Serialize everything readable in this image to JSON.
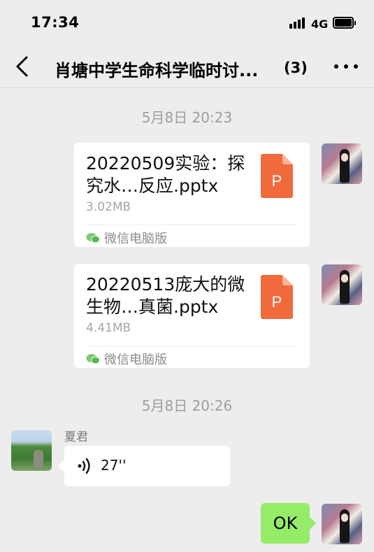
{
  "status_bar": {
    "time": "17:34",
    "network": "4G",
    "signal_icon": "signal-bars-icon",
    "battery_icon": "battery-full-icon"
  },
  "nav": {
    "back_icon": "chevron-left-icon",
    "title": "肖塘中学生命科学临时讨...",
    "member_count": "(3)",
    "more_icon": "more-dots-icon"
  },
  "messages": [
    {
      "type": "timestamp",
      "text": "5月8日 20:23"
    },
    {
      "type": "file",
      "sender": "self",
      "file_name": "20220509实验：探究水…反应.pptx",
      "file_size": "3.02MB",
      "source": "微信电脑版",
      "file_icon": "ppt-file-icon",
      "badge": "P"
    },
    {
      "type": "file",
      "sender": "self",
      "file_name": "20220513庞大的微生物…真菌.pptx",
      "file_size": "4.41MB",
      "source": "微信电脑版",
      "file_icon": "ppt-file-icon",
      "badge": "P"
    },
    {
      "type": "timestamp",
      "text": "5月8日 20:26"
    },
    {
      "type": "voice",
      "sender": "other",
      "sender_name": "夏君",
      "duration": "27''",
      "voice_icon": "voice-wave-icon"
    },
    {
      "type": "text",
      "sender": "self",
      "text": "OK"
    }
  ],
  "colors": {
    "background": "#ededed",
    "self_bubble": "#95ec69",
    "ppt_orange": "#f06a3b",
    "wechat_green": "#07c160"
  }
}
